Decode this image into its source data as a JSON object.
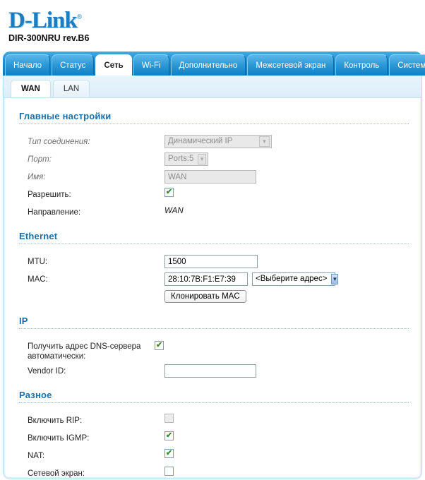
{
  "brand": {
    "logo_text": "D-Link",
    "logo_registered": "®",
    "model": "DIR-300NRU rev.B6",
    "accent_color": "#1b7ec2",
    "tab_color": "#2b97d6",
    "section_heading_color": "#1b6fa8",
    "check_color": "#3d8b2e"
  },
  "nav": {
    "tabs": [
      {
        "label": "Начало",
        "active": false
      },
      {
        "label": "Статус",
        "active": false
      },
      {
        "label": "Сеть",
        "active": true
      },
      {
        "label": "Wi-Fi",
        "active": false
      },
      {
        "label": "Дополнительно",
        "active": false
      },
      {
        "label": "Межсетевой экран",
        "active": false
      },
      {
        "label": "Контроль",
        "active": false
      },
      {
        "label": "Система",
        "active": false
      }
    ]
  },
  "subnav": {
    "tabs": [
      {
        "label": "WAN",
        "active": true
      },
      {
        "label": "LAN",
        "active": false
      }
    ]
  },
  "sections": {
    "main": {
      "title": "Главные настройки",
      "connection_type": {
        "label": "Тип соединения:",
        "value": "Динамический IP"
      },
      "port": {
        "label": "Порт:",
        "value": "Ports:5"
      },
      "name": {
        "label": "Имя:",
        "value": "WAN"
      },
      "enable": {
        "label": "Разрешить:",
        "checked": true,
        "glyph": "✔"
      },
      "direction": {
        "label": "Направление:",
        "value": "WAN"
      }
    },
    "ethernet": {
      "title": "Ethernet",
      "mtu": {
        "label": "MTU:",
        "value": "1500"
      },
      "mac": {
        "label": "MAC:",
        "value": "28:10:7B:F1:E7:39",
        "select_value": "<Выберите адрес>"
      },
      "clone_button": "Клонировать MAC"
    },
    "ip": {
      "title": "IP",
      "dns_auto": {
        "label": "Получить адрес DNS-сервера автоматически:",
        "checked": true,
        "glyph": "✔"
      },
      "vendor_id": {
        "label": "Vendor ID:",
        "value": "",
        "placeholder": ""
      }
    },
    "misc": {
      "title": "Разное",
      "rip": {
        "label": "Включить RIP:",
        "checked": false,
        "glyph": ""
      },
      "igmp": {
        "label": "Включить IGMP:",
        "checked": true,
        "glyph": "✔"
      },
      "nat": {
        "label": "NAT:",
        "checked": true,
        "glyph": "✔"
      },
      "firewall": {
        "label": "Сетевой экран:",
        "checked": false,
        "glyph": ""
      }
    }
  },
  "icons": {
    "dropdown_arrow": "▼"
  }
}
